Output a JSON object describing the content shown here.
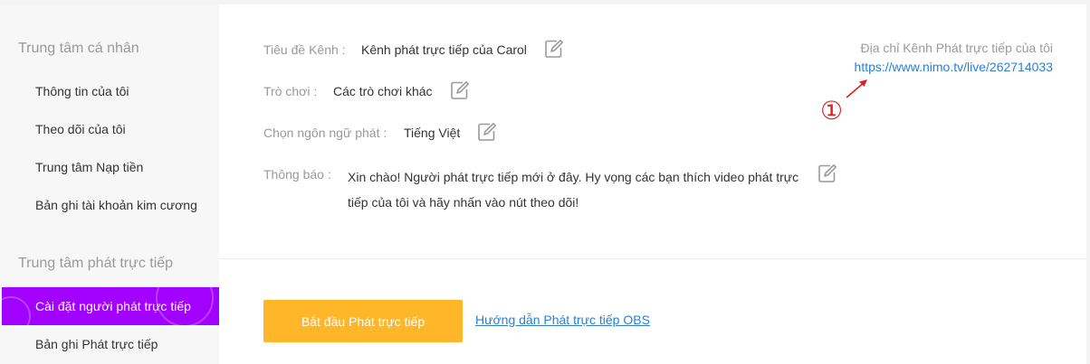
{
  "sidebar": {
    "section_personal": "Trung tâm cá nhân",
    "personal_items": [
      {
        "label": "Thông tin của tôi"
      },
      {
        "label": "Theo dõi của tôi"
      },
      {
        "label": "Trung tâm Nạp tiền"
      },
      {
        "label": "Bản ghi tài khoản kim cương"
      }
    ],
    "section_streaming": "Trung tâm phát trực tiếp",
    "streaming_items": [
      {
        "label": "Cài đặt người phát trực tiếp",
        "active": true
      },
      {
        "label": "Bản ghi Phát trực tiếp",
        "active": false
      }
    ]
  },
  "channel": {
    "title_label": "Tiêu đề Kênh :",
    "title_value": "Kênh phát trực tiếp của Carol",
    "game_label": "Trò chơi :",
    "game_value": "Các trò chơi khác",
    "language_label": "Chọn ngôn ngữ phát :",
    "language_value": "Tiếng Việt",
    "notice_label": "Thông báo :",
    "notice_value": "Xin chào! Người phát trực tiếp mới ở đây. Hy vọng các bạn thích video phát trực tiếp của tôi và hãy nhấn vào nút theo dõi!",
    "address_label": "Địa chỉ Kênh Phát trực tiếp của tôi",
    "address_url": "https://www.nimo.tv/live/262714033"
  },
  "annotation": {
    "marker": "①",
    "color": "#e02020"
  },
  "actions": {
    "start_button": "Bắt đầu Phát trực tiếp",
    "obs_guide_link": "Hướng dẫn Phát trực tiếp OBS"
  },
  "colors": {
    "accent": "#a200ff",
    "button": "#ffb629",
    "link": "#2c7fd3"
  },
  "icons": {
    "edit": "edit-icon",
    "arrow": "annotation-arrow-icon"
  }
}
